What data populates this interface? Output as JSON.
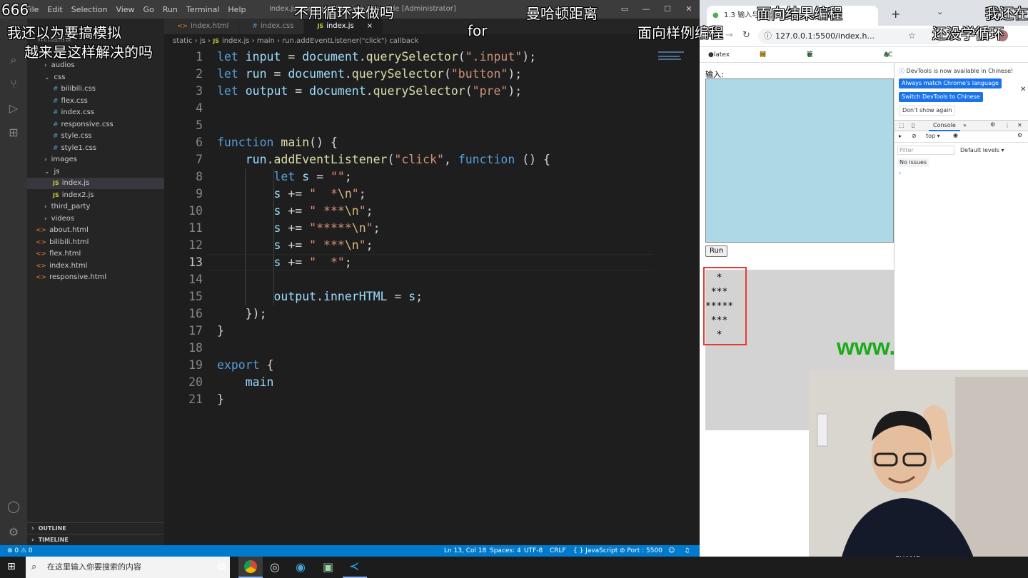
{
  "vscode": {
    "menu": [
      "File",
      "Edit",
      "Selection",
      "View",
      "Go",
      "Run",
      "Terminal",
      "Help"
    ],
    "window_title": "index.js - acapp - Visual Studio Code [Administrator]",
    "explorer_header": "WEB应用课",
    "tree": [
      {
        "label": "audios",
        "kind": "folder-closed",
        "depth": 1
      },
      {
        "label": "css",
        "kind": "folder-open",
        "depth": 1
      },
      {
        "label": "bilibili.css",
        "kind": "css",
        "depth": 2
      },
      {
        "label": "flex.css",
        "kind": "css",
        "depth": 2
      },
      {
        "label": "index.css",
        "kind": "css",
        "depth": 2
      },
      {
        "label": "responsive.css",
        "kind": "css",
        "depth": 2
      },
      {
        "label": "style.css",
        "kind": "css",
        "depth": 2
      },
      {
        "label": "style1.css",
        "kind": "css",
        "depth": 2
      },
      {
        "label": "images",
        "kind": "folder-closed",
        "depth": 1
      },
      {
        "label": "js",
        "kind": "folder-open",
        "depth": 1
      },
      {
        "label": "index.js",
        "kind": "js",
        "depth": 2,
        "selected": true
      },
      {
        "label": "index2.js",
        "kind": "js",
        "depth": 2
      },
      {
        "label": "third_party",
        "kind": "folder-closed",
        "depth": 1
      },
      {
        "label": "videos",
        "kind": "folder-closed",
        "depth": 1
      },
      {
        "label": "about.html",
        "kind": "html",
        "depth": 0
      },
      {
        "label": "bilibili.html",
        "kind": "html",
        "depth": 0
      },
      {
        "label": "flex.html",
        "kind": "html",
        "depth": 0
      },
      {
        "label": "index.html",
        "kind": "html",
        "depth": 0
      },
      {
        "label": "responsive.html",
        "kind": "html",
        "depth": 0
      }
    ],
    "outline_label": "OUTLINE",
    "timeline_label": "TIMELINE",
    "tabs": [
      {
        "label": "index.html",
        "icon": "html"
      },
      {
        "label": "index.css",
        "icon": "css"
      },
      {
        "label": "index.js",
        "icon": "js",
        "active": true,
        "close": "×"
      }
    ],
    "breadcrumb": [
      "static",
      "js",
      "index.js",
      "main",
      "run.addEventListener(\"click\") callback"
    ],
    "code_lines": [
      "let input = document.querySelector(\".input\");",
      "let run = document.querySelector(\"button\");",
      "let output = document.querySelector(\"pre\");",
      "",
      "",
      "function main() {",
      "    run.addEventListener(\"click\", function () {",
      "        let s = \"\";",
      "        s += \"  *\\n\";",
      "        s += \" ***\\n\";",
      "        s += \"*****\\n\";",
      "        s += \" ***\\n\";",
      "        s += \"  *\";",
      "",
      "        output.innerHTML = s;",
      "    });",
      "}",
      "",
      "export {",
      "    main",
      "}"
    ],
    "current_line": 13,
    "status": {
      "problems": "⊗ 0 ⚠ 0",
      "position": "Ln 13, Col 18",
      "spaces": "Spaces: 4",
      "encoding": "UTF-8",
      "eol": "CRLF",
      "language": "{ } JavaScript",
      "port": "⊘ Port : 5500"
    }
  },
  "browser": {
    "tab_title": "1.3 输入与输出",
    "url": "127.0.0.1:5500/index.h...",
    "bookmarks": [
      "latex 语法",
      "网站相关",
      "管理员审核列表 -...",
      "AC之星计划"
    ],
    "page": {
      "input_label": "输入:",
      "run_button": "Run",
      "output_lines": [
        "  *",
        " ***",
        "*****",
        " ***",
        "  *"
      ],
      "watermark": "www.acwing.com"
    },
    "devtools": {
      "notice": "DevTools is now available in Chinese!",
      "btn_match": "Always match Chrome's language",
      "btn_switch": "Switch DevTools to Chinese",
      "btn_dont_show": "Don't show again",
      "console_tab": "Console",
      "context": "top ▾",
      "filter_placeholder": "Filter",
      "levels": "Default levels ▾",
      "issues": "No issues"
    }
  },
  "subtitles": [
    "666",
    "不用循环来做吗",
    "曼哈顿距离",
    "面向结果编程",
    "我还在",
    "我还以为要搞模拟",
    "for",
    "面向样例编程",
    "还没学循环",
    "越来是这样解决的吗"
  ],
  "taskbar": {
    "search_placeholder": "在这里输入你要搜索的内容"
  },
  "colors": {
    "editor_bg": "#1e1e1e",
    "statusbar": "#007acc",
    "textarea_bg": "#add8e6",
    "output_border": "#e53935",
    "watermark": "#1aab1a"
  }
}
